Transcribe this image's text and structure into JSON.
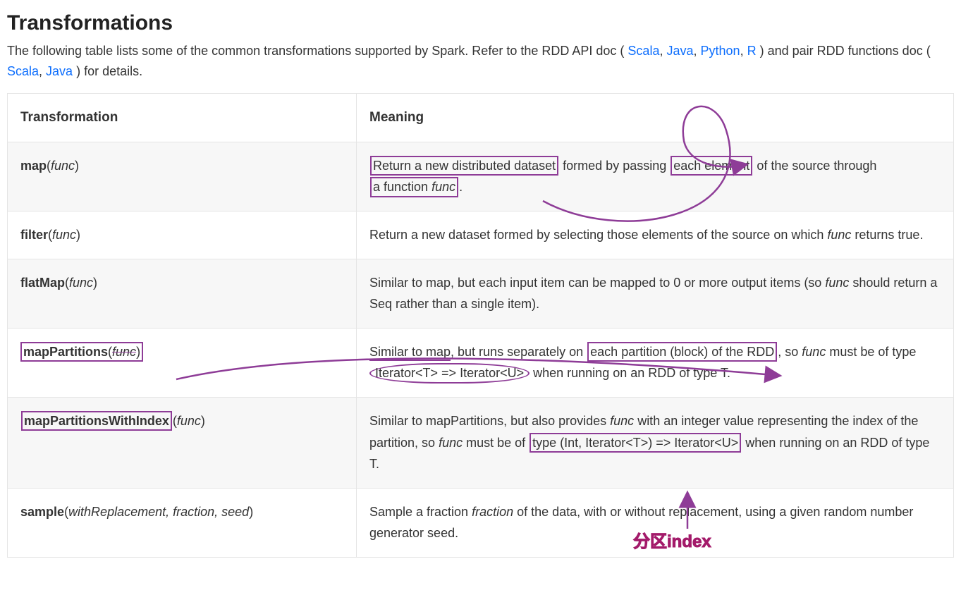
{
  "heading": "Transformations",
  "intro": {
    "pre": "The following table lists some of the common transformations supported by Spark. Refer to the RDD API doc (",
    "links_api": [
      "Scala",
      "Java",
      "Python",
      "R"
    ],
    "mid": ") and pair RDD functions doc (",
    "links_pair": [
      "Scala",
      "Java"
    ],
    "post": ") for details."
  },
  "table": {
    "headers": {
      "transformation": "Transformation",
      "meaning": "Meaning"
    },
    "rows": [
      {
        "fn": "map",
        "params": "func",
        "meaning": {
          "seg0": "Return a new distributed dataset",
          "seg1": " formed by passing ",
          "seg2": "each element",
          "seg3": " of the source through ",
          "seg4": "a function ",
          "seg4_it": "func",
          "seg5": "."
        }
      },
      {
        "fn": "filter",
        "params": "func",
        "meaning": {
          "pre": "Return a new dataset formed by selecting those elements of the source on which ",
          "it": "func",
          "post": " returns true."
        }
      },
      {
        "fn": "flatMap",
        "params": "func",
        "meaning": {
          "pre": "Similar to map, but each input item can be mapped to 0 or more output items (so ",
          "it": "func",
          "post": " should return a Seq rather than a single item)."
        }
      },
      {
        "fn": "mapPartitions",
        "params": "func",
        "meaning": {
          "seg0": "Similar to map",
          "seg1": ", but runs separately on ",
          "seg2": "each partition (block) of the RDD",
          "seg3": ", so ",
          "it": "func",
          "seg4": " must be of type ",
          "seg5": "Iterator<T> => Iterator<U>",
          "seg6": " when running on an RDD of type T."
        }
      },
      {
        "fn": "mapPartitionsWithIndex",
        "params": "func",
        "meaning": {
          "seg0": "Similar to mapPartitions, but also provides ",
          "it1": "func",
          "seg1": " with an integer value representing the index of the partition, so ",
          "it2": "func",
          "seg2": " must be of ",
          "seg3": "type (Int, Iterator<T>) => Iterator<U>",
          "seg4": " when running on an RDD of type T."
        }
      },
      {
        "fn": "sample",
        "params": "withReplacement, fraction, seed",
        "meaning": {
          "pre": "Sample a fraction ",
          "it": "fraction",
          "post": " of the data, with or without replacement, using a given random number generator seed."
        }
      }
    ]
  },
  "annotation_label": "分区index",
  "colors": {
    "purple": "#8e3c97",
    "label": "#a31a6a",
    "link": "#0d6efd"
  }
}
